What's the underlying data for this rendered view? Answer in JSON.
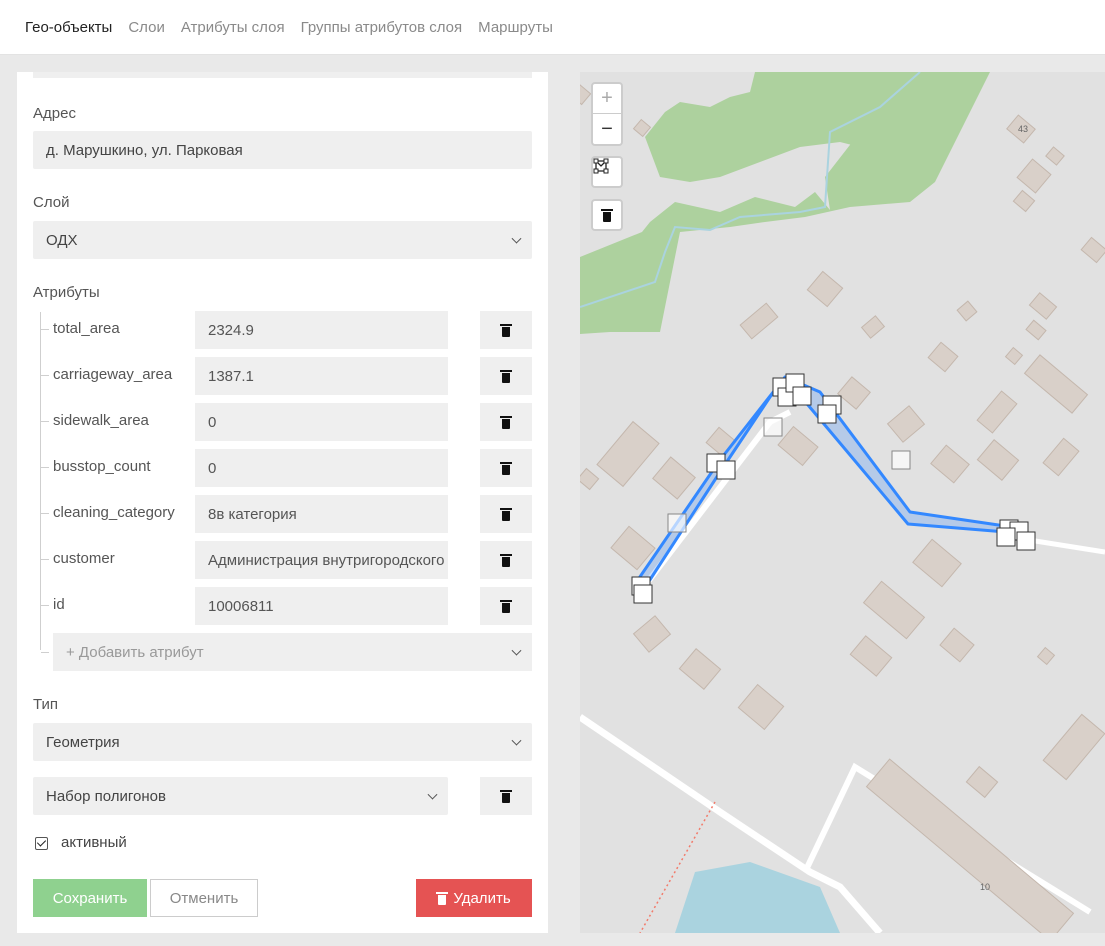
{
  "nav": {
    "tabs": [
      {
        "label": "Гео-объекты"
      },
      {
        "label": "Слои"
      },
      {
        "label": "Атрибуты слоя"
      },
      {
        "label": "Группы атрибутов слоя"
      },
      {
        "label": "Маршруты"
      }
    ]
  },
  "form": {
    "address_label": "Адрес",
    "address_value": "д. Марушкино, ул. Парковая",
    "layer_label": "Слой",
    "layer_value": "ОДХ",
    "attributes_label": "Атрибуты",
    "attributes": [
      {
        "name": "total_area",
        "value": "2324.9"
      },
      {
        "name": "carriageway_area",
        "value": "1387.1"
      },
      {
        "name": "sidewalk_area",
        "value": "0"
      },
      {
        "name": "busstop_count",
        "value": "0"
      },
      {
        "name": "cleaning_category",
        "value": "8в категория"
      },
      {
        "name": "customer",
        "value": "Администрация внутригородского"
      },
      {
        "name": "id",
        "value": "10006811"
      }
    ],
    "add_attribute_placeholder": "+ Добавить атрибут",
    "type_label": "Тип",
    "type_value": "Геометрия",
    "geometry_value": "Набор полигонов",
    "active_label": "активный",
    "active_checked": true,
    "save_label": "Сохранить",
    "cancel_label": "Отменить",
    "delete_label": "Удалить"
  },
  "map": {
    "zoom_in": "+",
    "zoom_out": "−",
    "house_numbers": [
      "43",
      "10"
    ],
    "colors": {
      "forest": "#add19e",
      "building": "#d9d0c9",
      "selection": "#3388ff",
      "background": "#e1e1e1",
      "water": "#aad3df"
    }
  }
}
